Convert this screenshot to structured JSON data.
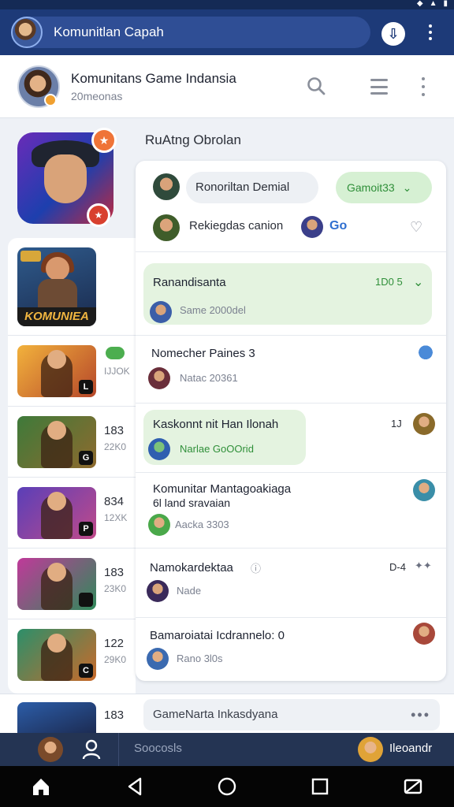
{
  "appbar": {
    "title": "Komunitlan Capah",
    "sync_icon": "download-sync-icon",
    "more_icon": "vertical-dots-icon"
  },
  "community": {
    "name": "Komunitans Game Indansia",
    "members": "20meonas",
    "search_icon": "search-icon",
    "menu_icon": "hamburger-icon",
    "more_icon": "vertical-dots-icon"
  },
  "rail": {
    "featured_badge_top": "★",
    "featured_badge_bottom": "★",
    "items": [
      {
        "banner": "KOMUNIEA",
        "count": "",
        "sub": ""
      },
      {
        "count": "",
        "sub": "IJJOK",
        "corner": "L"
      },
      {
        "count": "183",
        "sub": "22K0",
        "corner": "G"
      },
      {
        "count": "834",
        "sub": "12XK",
        "corner": "P"
      },
      {
        "count": "183",
        "sub": "23K0",
        "corner": ""
      },
      {
        "count": "122",
        "sub": "29K0",
        "corner": "C"
      }
    ]
  },
  "chat": {
    "section_title": "RuAtng Obrolan",
    "pinned": {
      "chip_label": "Ronoriltan Demial",
      "status_label": "Gamoit33",
      "status_chevron": "⌄",
      "line2": "Rekiegdas canion",
      "go_label": "Go"
    },
    "messages": [
      {
        "title": "Ranandisanta",
        "right": "1D0 5",
        "sub": "Same 2000del"
      },
      {
        "title": "Nomecher Paines 3",
        "right": "",
        "sub": "Natac 20361"
      },
      {
        "title": "Kaskonnt nit Han Ilonah",
        "right": "1J",
        "sub": "Narlae GoOOrid"
      },
      {
        "title": "Komunitar Mantagoakiaga",
        "title2": "6l land sravaian",
        "right": "",
        "sub": "Aacka 3303"
      },
      {
        "title": "Namokardektaa",
        "right": "D-4",
        "sub": "Nade"
      },
      {
        "title": "Bamaroiatai Icdrannelo: 0",
        "right": "",
        "sub": "Rano 3l0s"
      }
    ]
  },
  "composer": {
    "count": "183",
    "placeholder": "GameNarta Inkasdyana",
    "more_label": "•••"
  },
  "tabbar": {
    "search_label": "Soocosls",
    "user_name": "Ileoandr"
  },
  "colors": {
    "appbar": "#1d3a78",
    "accent_green": "#2f8f39",
    "tabbar": "#243453"
  }
}
